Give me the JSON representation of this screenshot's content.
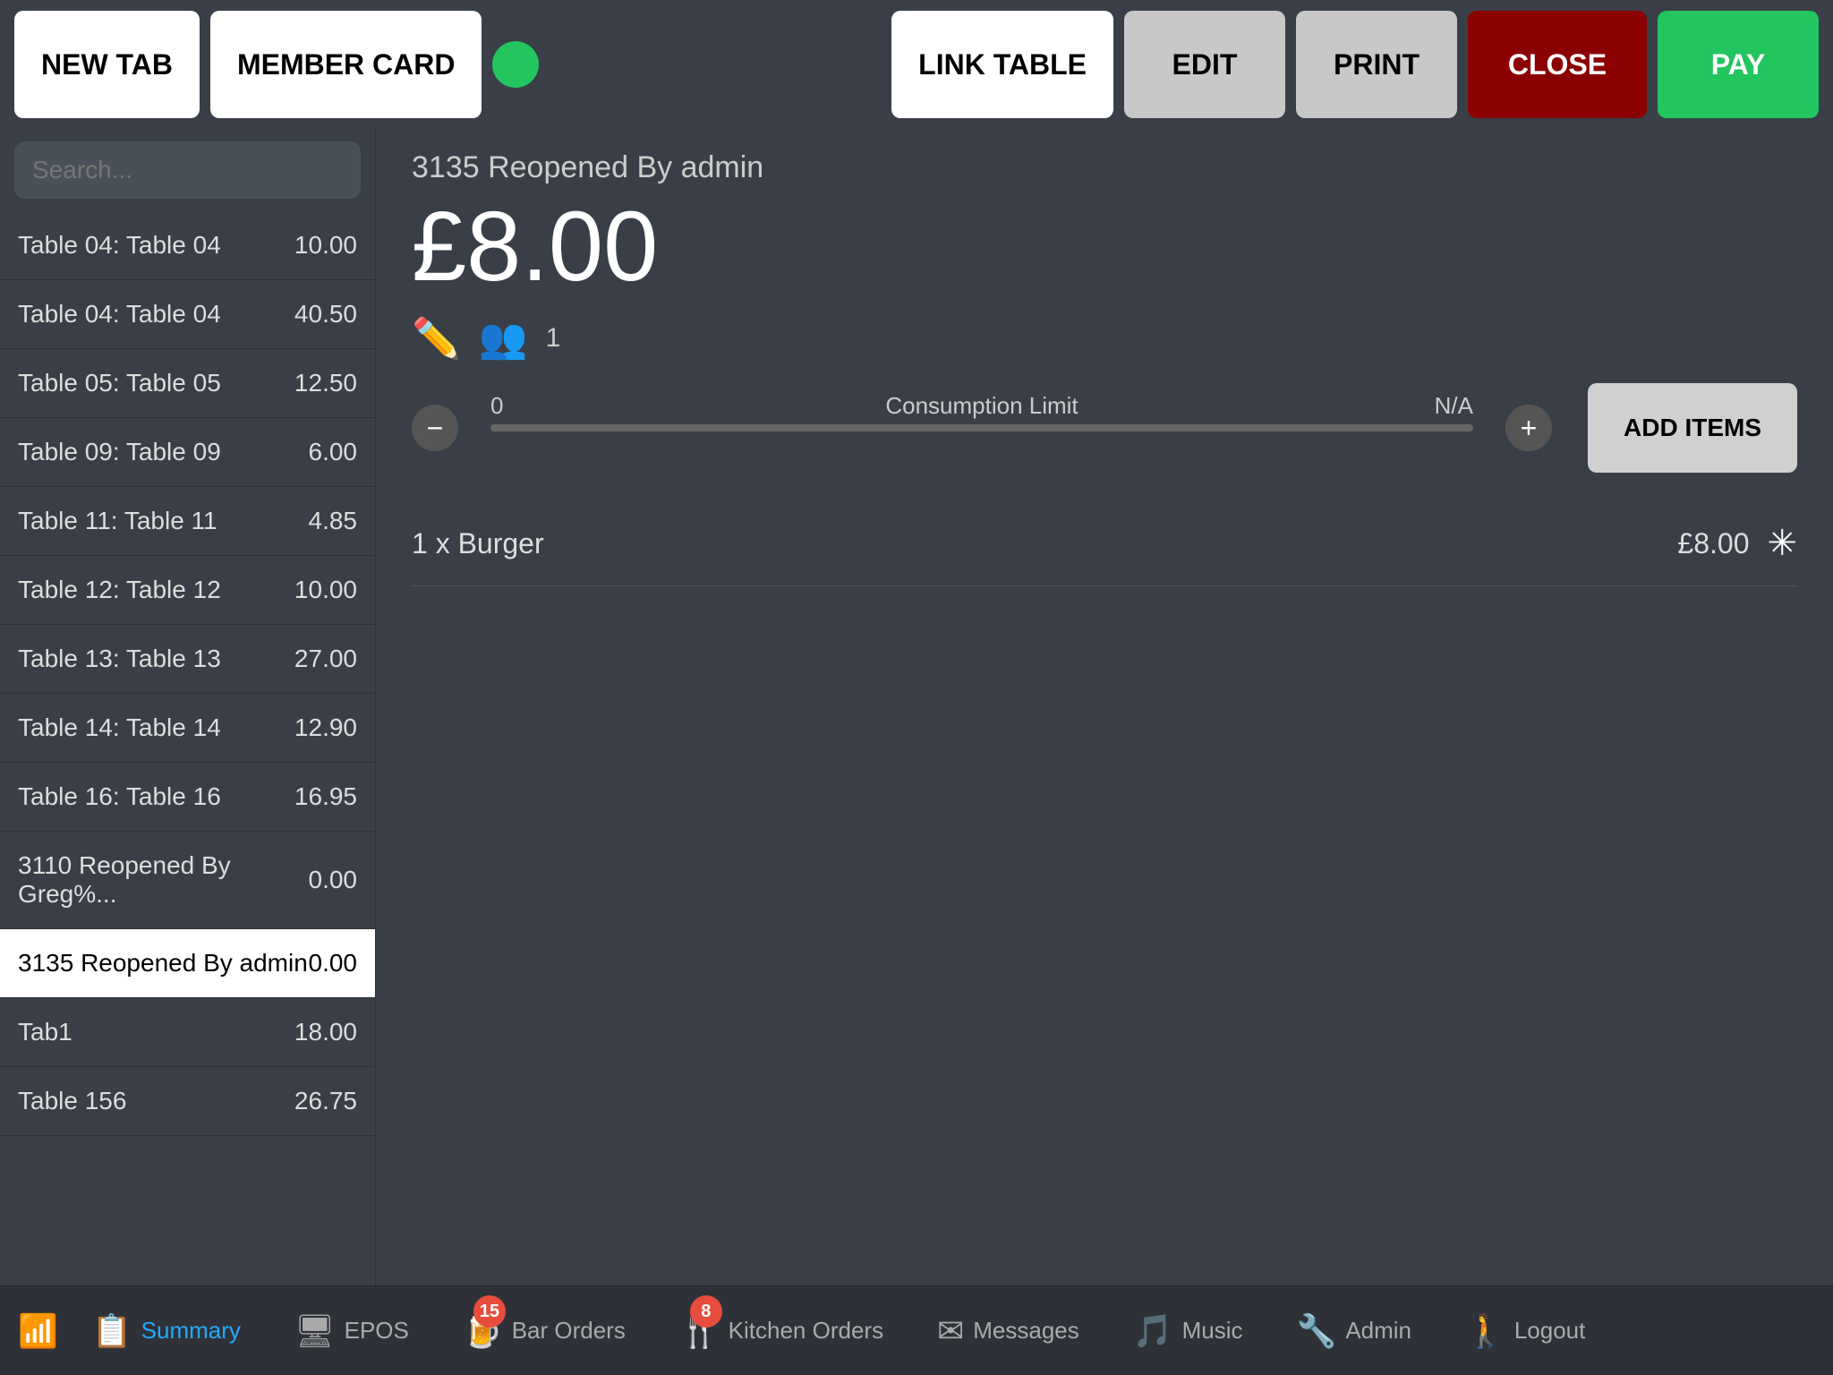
{
  "toolbar": {
    "new_tab_label": "NEW TAB",
    "member_card_label": "MEMBER CARD",
    "link_table_label": "LINK TABLE",
    "edit_label": "EDIT",
    "print_label": "PRINT",
    "close_label": "CLOSE",
    "pay_label": "PAY"
  },
  "sidebar": {
    "search_placeholder": "Search...",
    "tables": [
      {
        "name": "Table 04: Table 04",
        "amount": "10.00",
        "active": false
      },
      {
        "name": "Table 04: Table 04",
        "amount": "40.50",
        "active": false
      },
      {
        "name": "Table 05: Table 05",
        "amount": "12.50",
        "active": false
      },
      {
        "name": "Table 09: Table 09",
        "amount": "6.00",
        "active": false
      },
      {
        "name": "Table 11: Table 11",
        "amount": "4.85",
        "active": false
      },
      {
        "name": "Table 12: Table 12",
        "amount": "10.00",
        "active": false
      },
      {
        "name": "Table 13: Table 13",
        "amount": "27.00",
        "active": false
      },
      {
        "name": "Table 14: Table 14",
        "amount": "12.90",
        "active": false
      },
      {
        "name": "Table 16: Table 16",
        "amount": "16.95",
        "active": false
      },
      {
        "name": "3110 Reopened By Greg%...",
        "amount": "0.00",
        "active": false
      },
      {
        "name": "3135 Reopened By admin",
        "amount": "0.00",
        "active": true
      },
      {
        "name": "Tab1",
        "amount": "18.00",
        "active": false
      },
      {
        "name": "Table 156",
        "amount": "26.75",
        "active": false
      }
    ]
  },
  "main": {
    "tab_title": "3135 Reopened By admin",
    "tab_amount": "£8.00",
    "consumption_label": "Consumption Limit",
    "consumption_min": "0",
    "consumption_max": "N/A",
    "add_items_label": "ADD ITEMS",
    "order_items": [
      {
        "name": "1 x Burger",
        "price": "£8.00"
      }
    ],
    "guest_count": "1"
  },
  "bottom_nav": {
    "items": [
      {
        "id": "summary",
        "label": "Summary",
        "active": true,
        "badge": null,
        "icon": "📋"
      },
      {
        "id": "epos",
        "label": "EPOS",
        "active": false,
        "badge": null,
        "icon": "🖥"
      },
      {
        "id": "bar-orders",
        "label": "Bar Orders",
        "active": false,
        "badge": "15",
        "icon": "🍺"
      },
      {
        "id": "kitchen-orders",
        "label": "Kitchen Orders",
        "active": false,
        "badge": "8",
        "icon": "🍴"
      },
      {
        "id": "messages",
        "label": "Messages",
        "active": false,
        "badge": null,
        "icon": "✉"
      },
      {
        "id": "music",
        "label": "Music",
        "active": false,
        "badge": null,
        "icon": "🎵"
      },
      {
        "id": "admin",
        "label": "Admin",
        "active": false,
        "badge": null,
        "icon": "🔧"
      },
      {
        "id": "logout",
        "label": "Logout",
        "active": false,
        "badge": null,
        "icon": "🚪"
      }
    ]
  }
}
